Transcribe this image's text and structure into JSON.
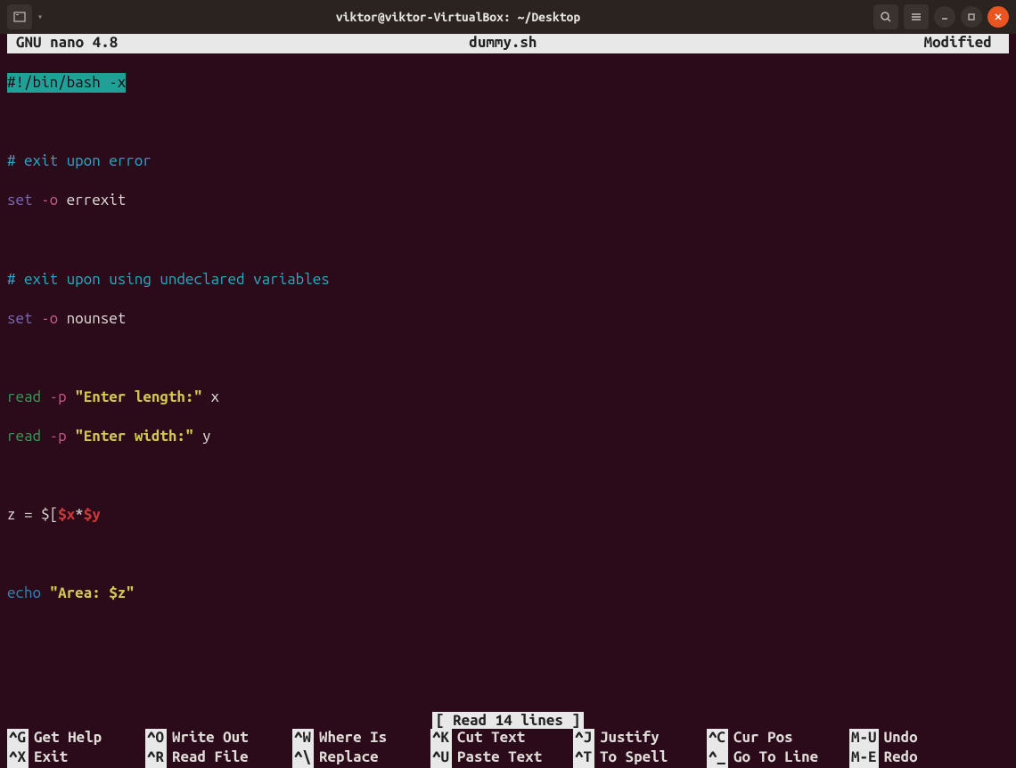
{
  "window": {
    "title": "viktor@viktor-VirtualBox: ~/Desktop"
  },
  "nano": {
    "version": "GNU nano 4.8",
    "filename": "dummy.sh",
    "status": "Modified",
    "message": "[ Read 14 lines ]"
  },
  "code": {
    "shebang": "#!/bin/bash -x",
    "comment1": "# exit upon error",
    "set1_cmd": "set",
    "set1_flag": " -o",
    "set1_arg": " errexit",
    "comment2": "# exit upon using undeclared variables",
    "set2_cmd": "set",
    "set2_flag": " -o",
    "set2_arg": " nounset",
    "read1_cmd": "read",
    "read1_flag": " -p",
    "read1_str": " \"Enter length:\"",
    "read1_var": " x",
    "read2_cmd": "read",
    "read2_flag": " -p",
    "read2_str": " \"Enter width:\"",
    "read2_var": " y",
    "z_lhs": "z = $[",
    "z_var1": "$x",
    "z_star": "*",
    "z_var2": "$y",
    "echo_cmd": "echo",
    "echo_str": " \"Area: $z\""
  },
  "shortcuts": {
    "row1": [
      {
        "key": "^G",
        "label": "Get Help"
      },
      {
        "key": "^O",
        "label": "Write Out"
      },
      {
        "key": "^W",
        "label": "Where Is"
      },
      {
        "key": "^K",
        "label": "Cut Text"
      },
      {
        "key": "^J",
        "label": "Justify"
      },
      {
        "key": "^C",
        "label": "Cur Pos"
      },
      {
        "key": "M-U",
        "label": "Undo"
      }
    ],
    "row2": [
      {
        "key": "^X",
        "label": "Exit"
      },
      {
        "key": "^R",
        "label": "Read File"
      },
      {
        "key": "^\\",
        "label": "Replace"
      },
      {
        "key": "^U",
        "label": "Paste Text"
      },
      {
        "key": "^T",
        "label": "To Spell"
      },
      {
        "key": "^_",
        "label": "Go To Line"
      },
      {
        "key": "M-E",
        "label": "Redo"
      }
    ]
  }
}
